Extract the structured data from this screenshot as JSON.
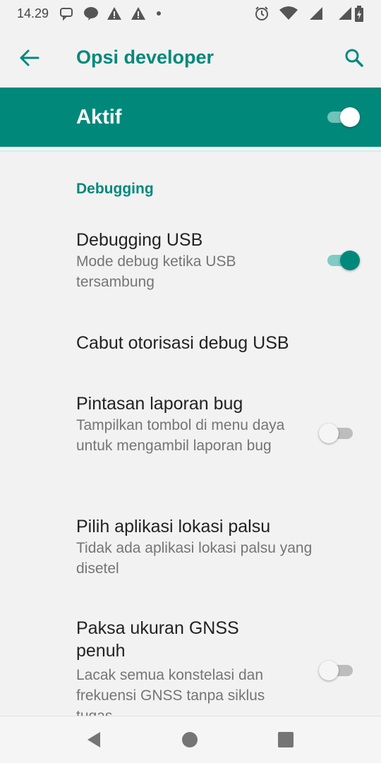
{
  "status_bar": {
    "time": "14.29"
  },
  "app_bar": {
    "title": "Opsi developer"
  },
  "master": {
    "label": "Aktif",
    "on": true
  },
  "section": {
    "header": "Debugging"
  },
  "prefs": [
    {
      "title": "Debugging USB",
      "summary": "Mode debug ketika USB tersambung",
      "toggle": true
    },
    {
      "title": "Cabut otorisasi debug USB",
      "summary": ""
    },
    {
      "title": "Pintasan laporan bug",
      "summary": "Tampilkan tombol di menu daya untuk mengambil laporan bug",
      "toggle": false
    },
    {
      "title": "Pilih aplikasi lokasi palsu",
      "summary": "Tidak ada aplikasi lokasi palsu yang disetel"
    },
    {
      "title": "Paksa ukuran GNSS penuh",
      "summary": "Lacak semua konstelasi dan frekuensi GNSS tanpa siklus tugas",
      "toggle": false
    }
  ],
  "icons": {
    "back": "arrow-left-icon",
    "search": "search-icon",
    "nav_back": "triangle-back-icon",
    "nav_home": "circle-home-icon",
    "nav_recents": "square-recents-icon"
  },
  "colors": {
    "accent": "#00897b",
    "track_on": "#80cbc4",
    "background": "#f2f2f2"
  }
}
